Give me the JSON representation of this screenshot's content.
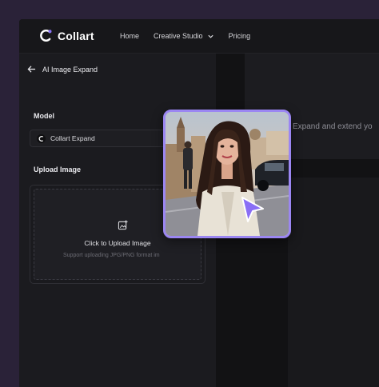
{
  "brand": {
    "name": "Collart",
    "accent": "#7d63f0"
  },
  "nav": {
    "items": [
      {
        "label": "Home"
      },
      {
        "label": "Creative Studio"
      },
      {
        "label": "Pricing"
      }
    ]
  },
  "panel": {
    "back_label": "AI Image Expand",
    "model_label": "Model",
    "model_value": "Collart Expand",
    "upload_label": "Upload Image",
    "upload_title": "Click to Upload Image",
    "upload_hint": "Support uploading JPG/PNG format im"
  },
  "canvas": {
    "banner_text": "Expand and extend yo"
  },
  "icons": {
    "back": "arrow-left-icon",
    "chevron": "chevron-down-icon",
    "upload": "image-upload-icon",
    "cursor": "pointer-cursor-icon"
  }
}
